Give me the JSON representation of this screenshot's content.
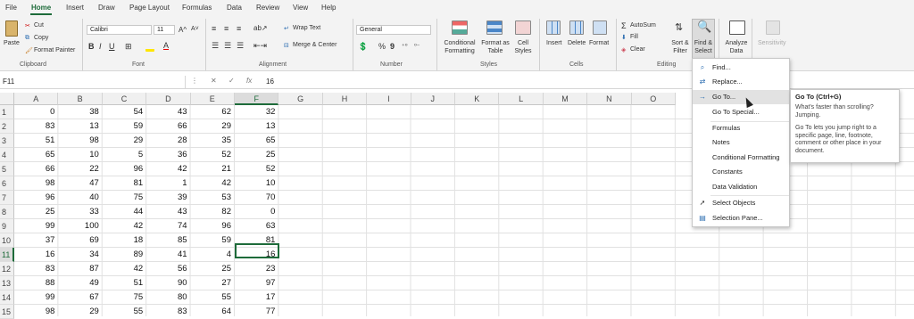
{
  "tabs": [
    "File",
    "Home",
    "Insert",
    "Draw",
    "Page Layout",
    "Formulas",
    "Data",
    "Review",
    "View",
    "Help"
  ],
  "active_tab": "Home",
  "clipboard": {
    "paste": "Paste",
    "cut": "Cut",
    "copy": "Copy",
    "format_painter": "Format Painter",
    "label": "Clipboard"
  },
  "font": {
    "name": "Calibri",
    "size": "11",
    "label": "Font"
  },
  "alignment": {
    "wrap": "Wrap Text",
    "merge": "Merge & Center",
    "label": "Alignment"
  },
  "number": {
    "format": "General",
    "label": "Number"
  },
  "styles": {
    "conditional": "Conditional Formatting",
    "format_as": "Format as Table",
    "cell": "Cell Styles",
    "label": "Styles"
  },
  "cells": {
    "insert": "Insert",
    "delete": "Delete",
    "format": "Format",
    "label": "Cells"
  },
  "editing": {
    "autosum": "AutoSum",
    "fill": "Fill",
    "clear": "Clear",
    "sort": "Sort & Filter",
    "find": "Find & Select",
    "label": "Editing"
  },
  "analysis": {
    "analyze": "Analyze Data"
  },
  "sensitivity": {
    "label": "Sensitivity"
  },
  "formula_bar": {
    "name_box": "F11",
    "fx": "fx",
    "value": "16"
  },
  "columns": [
    "A",
    "B",
    "C",
    "D",
    "E",
    "F",
    "G",
    "H",
    "I",
    "J",
    "K",
    "L",
    "M",
    "N",
    "O"
  ],
  "selected_column": "F",
  "selected_row": 11,
  "rows": [
    [
      0,
      38,
      54,
      43,
      62,
      32
    ],
    [
      83,
      13,
      59,
      66,
      29,
      13
    ],
    [
      51,
      98,
      29,
      28,
      35,
      65
    ],
    [
      65,
      10,
      5,
      36,
      52,
      25
    ],
    [
      66,
      22,
      96,
      42,
      21,
      52
    ],
    [
      98,
      47,
      81,
      1,
      42,
      10
    ],
    [
      96,
      40,
      75,
      39,
      53,
      70
    ],
    [
      25,
      33,
      44,
      43,
      82,
      0
    ],
    [
      99,
      100,
      42,
      74,
      96,
      63
    ],
    [
      37,
      69,
      18,
      85,
      59,
      81
    ],
    [
      16,
      34,
      89,
      41,
      4,
      16
    ],
    [
      83,
      87,
      42,
      56,
      25,
      23
    ],
    [
      88,
      49,
      51,
      90,
      27,
      97
    ],
    [
      99,
      67,
      75,
      80,
      55,
      17
    ],
    [
      98,
      29,
      55,
      83,
      64,
      77
    ]
  ],
  "dropdown": [
    {
      "label": "Find...",
      "icon": "search-icon",
      "highlight": false
    },
    {
      "label": "Replace...",
      "icon": "replace-icon",
      "highlight": false
    },
    {
      "label": "Go To...",
      "icon": "arrow-right-icon",
      "highlight": true
    },
    {
      "label": "Go To Special...",
      "icon": "",
      "highlight": false
    },
    {
      "label": "Formulas",
      "icon": "",
      "highlight": false
    },
    {
      "label": "Notes",
      "icon": "",
      "highlight": false
    },
    {
      "label": "Conditional Formatting",
      "icon": "",
      "highlight": false
    },
    {
      "label": "Constants",
      "icon": "",
      "highlight": false
    },
    {
      "label": "Data Validation",
      "icon": "",
      "highlight": false
    },
    {
      "label": "Select Objects",
      "icon": "pointer-icon",
      "highlight": false
    },
    {
      "label": "Selection Pane...",
      "icon": "pane-icon",
      "highlight": false
    }
  ],
  "tooltip": {
    "title": "Go To (Ctrl+G)",
    "line1": "What's faster than scrolling? Jumping.",
    "line2": "Go To lets you jump right to a specific page, line, footnote, comment or other place in your document."
  }
}
